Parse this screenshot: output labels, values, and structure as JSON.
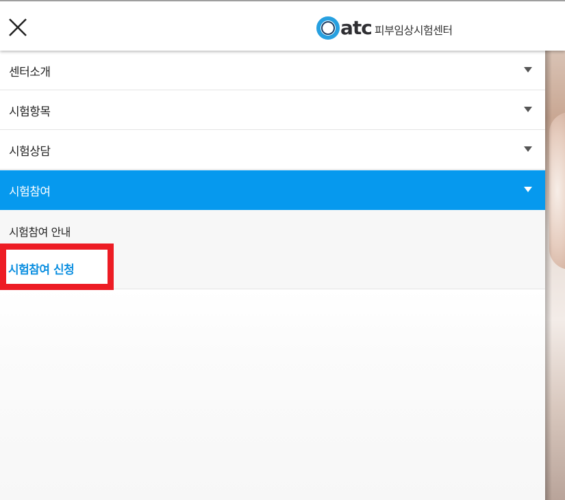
{
  "header": {
    "brand_mark": "atc",
    "brand_name": "피부임상시험센터"
  },
  "menu": {
    "items": [
      {
        "label": "센터소개"
      },
      {
        "label": "시험항목"
      },
      {
        "label": "시험상담"
      },
      {
        "label": "시험참여"
      }
    ],
    "submenu": [
      {
        "label": "시험참여 안내"
      },
      {
        "label": "시험참여 신청"
      }
    ]
  },
  "colors": {
    "active_bg": "#0699ee",
    "selected_text": "#0c8fe0",
    "highlight_border": "#ed1c24",
    "logo_ring_outer": "#27a0e0",
    "logo_ring_inner": "#1e3f66"
  },
  "icons": {
    "close": "close-icon",
    "expand": "chevron-down-icon"
  }
}
